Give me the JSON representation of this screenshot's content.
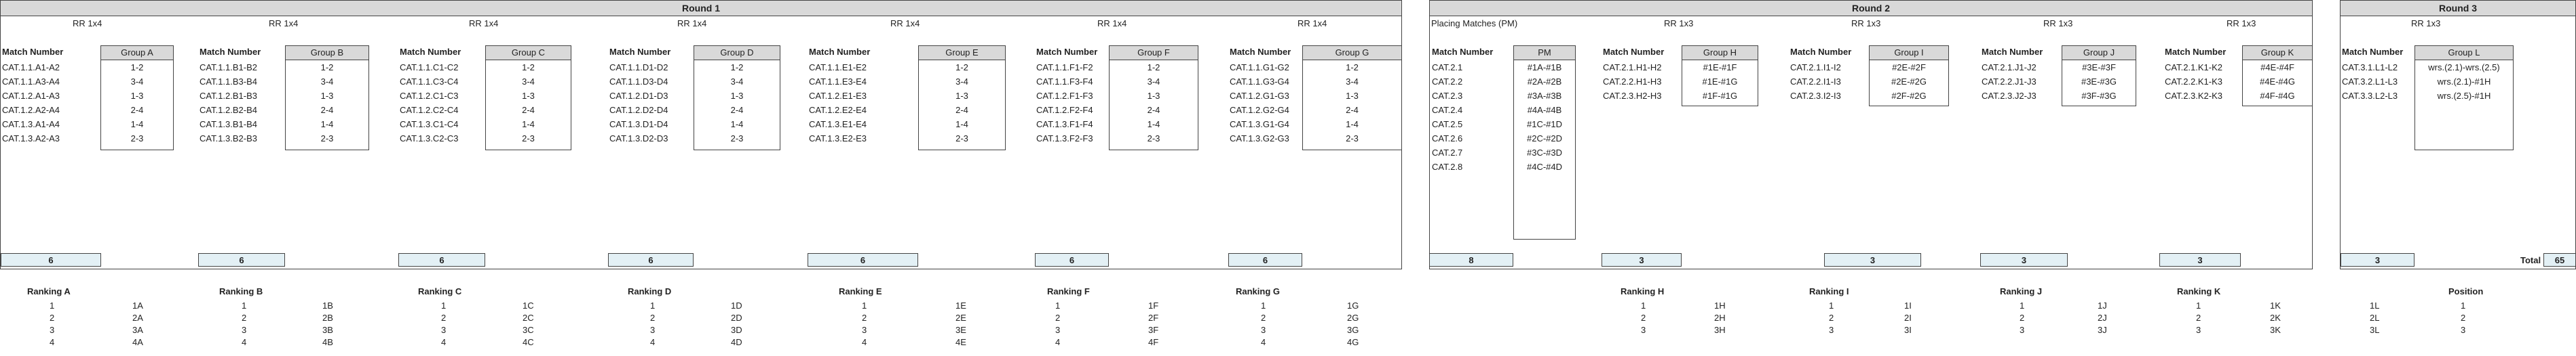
{
  "rounds": [
    {
      "title": "Round 1"
    },
    {
      "title": "Round 2"
    },
    {
      "title": "Round 3"
    }
  ],
  "placing_label": "Placing Matches (PM)",
  "match_header": "Match Number",
  "r1": {
    "format": "RR 1x4",
    "groups": [
      {
        "name": "Group A",
        "matches": [
          "CAT.1.1.A1-A2",
          "CAT.1.1.A3-A4",
          "CAT.1.2.A1-A3",
          "CAT.1.2.A2-A4",
          "CAT.1.3.A1-A4",
          "CAT.1.3.A2-A3"
        ],
        "pairs": [
          "1-2",
          "3-4",
          "1-3",
          "2-4",
          "1-4",
          "2-3"
        ],
        "count": "6"
      },
      {
        "name": "Group B",
        "matches": [
          "CAT.1.1.B1-B2",
          "CAT.1.1.B3-B4",
          "CAT.1.2.B1-B3",
          "CAT.1.2.B2-B4",
          "CAT.1.3.B1-B4",
          "CAT.1.3.B2-B3"
        ],
        "pairs": [
          "1-2",
          "3-4",
          "1-3",
          "2-4",
          "1-4",
          "2-3"
        ],
        "count": "6"
      },
      {
        "name": "Group C",
        "matches": [
          "CAT.1.1.C1-C2",
          "CAT.1.1.C3-C4",
          "CAT.1.2.C1-C3",
          "CAT.1.2.C2-C4",
          "CAT.1.3.C1-C4",
          "CAT.1.3.C2-C3"
        ],
        "pairs": [
          "1-2",
          "3-4",
          "1-3",
          "2-4",
          "1-4",
          "2-3"
        ],
        "count": "6"
      },
      {
        "name": "Group D",
        "matches": [
          "CAT.1.1.D1-D2",
          "CAT.1.1.D3-D4",
          "CAT.1.2.D1-D3",
          "CAT.1.2.D2-D4",
          "CAT.1.3.D1-D4",
          "CAT.1.3.D2-D3"
        ],
        "pairs": [
          "1-2",
          "3-4",
          "1-3",
          "2-4",
          "1-4",
          "2-3"
        ],
        "count": "6"
      },
      {
        "name": "Group E",
        "matches": [
          "CAT.1.1.E1-E2",
          "CAT.1.1.E3-E4",
          "CAT.1.2.E1-E3",
          "CAT.1.2.E2-E4",
          "CAT.1.3.E1-E4",
          "CAT.1.3.E2-E3"
        ],
        "pairs": [
          "1-2",
          "3-4",
          "1-3",
          "2-4",
          "1-4",
          "2-3"
        ],
        "count": "6"
      },
      {
        "name": "Group F",
        "matches": [
          "CAT.1.1.F1-F2",
          "CAT.1.1.F3-F4",
          "CAT.1.2.F1-F3",
          "CAT.1.2.F2-F4",
          "CAT.1.3.F1-F4",
          "CAT.1.3.F2-F3"
        ],
        "pairs": [
          "1-2",
          "3-4",
          "1-3",
          "2-4",
          "1-4",
          "2-3"
        ],
        "count": "6"
      },
      {
        "name": "Group G",
        "matches": [
          "CAT.1.1.G1-G2",
          "CAT.1.1.G3-G4",
          "CAT.1.2.G1-G3",
          "CAT.1.2.G2-G4",
          "CAT.1.3.G1-G4",
          "CAT.1.3.G2-G3"
        ],
        "pairs": [
          "1-2",
          "3-4",
          "1-3",
          "2-4",
          "1-4",
          "2-3"
        ],
        "count": "6"
      }
    ]
  },
  "r2": {
    "format": "RR 1x3",
    "pm": {
      "name": "PM",
      "matches": [
        "CAT.2.1",
        "CAT.2.2",
        "CAT.2.3",
        "CAT.2.4",
        "CAT.2.5",
        "CAT.2.6",
        "CAT.2.7",
        "CAT.2.8"
      ],
      "pairs": [
        "#1A-#1B",
        "#2A-#2B",
        "#3A-#3B",
        "#4A-#4B",
        "#1C-#1D",
        "#2C-#2D",
        "#3C-#3D",
        "#4C-#4D"
      ],
      "count": "8"
    },
    "groups": [
      {
        "name": "Group H",
        "matches": [
          "CAT.2.1.H1-H2",
          "CAT.2.2.H1-H3",
          "CAT.2.3.H2-H3"
        ],
        "pairs": [
          "#1E-#1F",
          "#1E-#1G",
          "#1F-#1G"
        ],
        "count": "3"
      },
      {
        "name": "Group I",
        "matches": [
          "CAT.2.1.I1-I2",
          "CAT.2.2.I1-I3",
          "CAT.2.3.I2-I3"
        ],
        "pairs": [
          "#2E-#2F",
          "#2E-#2G",
          "#2F-#2G"
        ],
        "count": "3"
      },
      {
        "name": "Group J",
        "matches": [
          "CAT.2.1.J1-J2",
          "CAT.2.2.J1-J3",
          "CAT.2.3.J2-J3"
        ],
        "pairs": [
          "#3E-#3F",
          "#3E-#3G",
          "#3F-#3G"
        ],
        "count": "3"
      },
      {
        "name": "Group K",
        "matches": [
          "CAT.2.1.K1-K2",
          "CAT.2.2.K1-K3",
          "CAT.2.3.K2-K3"
        ],
        "pairs": [
          "#4E-#4F",
          "#4E-#4G",
          "#4F-#4G"
        ],
        "count": "3"
      }
    ]
  },
  "r3": {
    "format": "RR 1x3",
    "group": {
      "name": "Group L",
      "matches": [
        "CAT.3.1.L1-L2",
        "CAT.3.2.L1-L3",
        "CAT.3.3.L2-L3"
      ],
      "pairs": [
        "wrs.(2.1)-wrs.(2.5)",
        "wrs.(2.1)-#1H",
        "wrs.(2.5)-#1H"
      ],
      "count": "3"
    }
  },
  "rankings": [
    {
      "title": "Ranking A",
      "nums": [
        "1",
        "2",
        "3",
        "4"
      ],
      "vals": [
        "1A",
        "2A",
        "3A",
        "4A"
      ]
    },
    {
      "title": "Ranking B",
      "nums": [
        "1",
        "2",
        "3",
        "4"
      ],
      "vals": [
        "1B",
        "2B",
        "3B",
        "4B"
      ]
    },
    {
      "title": "Ranking C",
      "nums": [
        "1",
        "2",
        "3",
        "4"
      ],
      "vals": [
        "1C",
        "2C",
        "3C",
        "4C"
      ]
    },
    {
      "title": "Ranking D",
      "nums": [
        "1",
        "2",
        "3",
        "4"
      ],
      "vals": [
        "1D",
        "2D",
        "3D",
        "4D"
      ]
    },
    {
      "title": "Ranking E",
      "nums": [
        "1",
        "2",
        "3",
        "4"
      ],
      "vals": [
        "1E",
        "2E",
        "3E",
        "4E"
      ]
    },
    {
      "title": "Ranking F",
      "nums": [
        "1",
        "2",
        "3",
        "4"
      ],
      "vals": [
        "1F",
        "2F",
        "3F",
        "4F"
      ]
    },
    {
      "title": "Ranking G",
      "nums": [
        "1",
        "2",
        "3",
        "4"
      ],
      "vals": [
        "1G",
        "2G",
        "3G",
        "4G"
      ]
    },
    {
      "title": "Ranking H",
      "nums": [
        "1",
        "2",
        "3"
      ],
      "vals": [
        "1H",
        "2H",
        "3H"
      ]
    },
    {
      "title": "Ranking I",
      "nums": [
        "1",
        "2",
        "3"
      ],
      "vals": [
        "1I",
        "2I",
        "3I"
      ]
    },
    {
      "title": "Ranking J",
      "nums": [
        "1",
        "2",
        "3"
      ],
      "vals": [
        "1J",
        "2J",
        "3J"
      ]
    },
    {
      "title": "Ranking K",
      "nums": [
        "1",
        "2",
        "3"
      ],
      "vals": [
        "1K",
        "2K",
        "3K"
      ]
    },
    {
      "title": "Position",
      "nums": [
        "1L",
        "2L",
        "3L"
      ],
      "vals": [
        "1",
        "2",
        "3"
      ]
    }
  ],
  "total": {
    "label": "Total",
    "value": "65"
  }
}
